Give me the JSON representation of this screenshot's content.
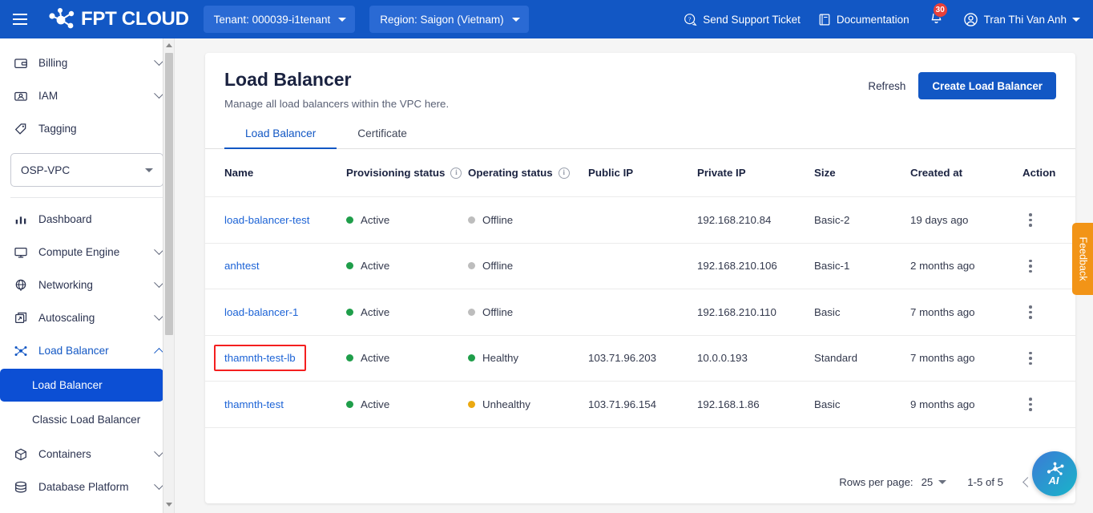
{
  "topbar": {
    "menu_icon": "hamburger-icon",
    "brand": "FPT CLOUD",
    "tenant_label": "Tenant: 000039-i1tenant",
    "region_label": "Region: Saigon (Vietnam)",
    "support_label": "Send Support Ticket",
    "documentation_label": "Documentation",
    "notification_count": "30",
    "user_name": "Tran Thi Van Anh",
    "accent_color": "#1257c4",
    "pill_color": "#2a6ad4",
    "badge_color": "#e8403a"
  },
  "sidebar": {
    "top_items": [
      {
        "label": "Billing",
        "icon": "billing-icon",
        "expandable": true
      },
      {
        "label": "IAM",
        "icon": "iam-icon",
        "expandable": true
      },
      {
        "label": "Tagging",
        "icon": "tag-icon",
        "expandable": false
      }
    ],
    "vpc_selector": {
      "value": "OSP-VPC"
    },
    "items": [
      {
        "label": "Dashboard",
        "icon": "dashboard-icon",
        "expandable": false
      },
      {
        "label": "Compute Engine",
        "icon": "monitor-icon",
        "expandable": true
      },
      {
        "label": "Networking",
        "icon": "globe-icon",
        "expandable": true
      },
      {
        "label": "Autoscaling",
        "icon": "autoscaling-icon",
        "expandable": true
      },
      {
        "label": "Load Balancer",
        "icon": "load-balancer-icon",
        "expandable": true,
        "expanded": true
      },
      {
        "label": "Containers",
        "icon": "container-icon",
        "expandable": true
      },
      {
        "label": "Database Platform",
        "icon": "database-icon",
        "expandable": true
      }
    ],
    "sub_items": [
      {
        "label": "Load Balancer",
        "selected": true
      },
      {
        "label": "Classic Load Balancer",
        "selected": false
      }
    ],
    "selected_color": "#0c4fd4"
  },
  "page": {
    "title": "Load Balancer",
    "subtitle": "Manage all load balancers within the VPC here.",
    "refresh_label": "Refresh",
    "create_label": "Create Load Balancer"
  },
  "tabs": [
    {
      "label": "Load Balancer",
      "active": true
    },
    {
      "label": "Certificate",
      "active": false
    }
  ],
  "table": {
    "columns": [
      {
        "label": "Name",
        "has_info": false
      },
      {
        "label": "Provisioning status",
        "has_info": true
      },
      {
        "label": "Operating status",
        "has_info": true
      },
      {
        "label": "Public IP",
        "has_info": false
      },
      {
        "label": "Private IP",
        "has_info": false
      },
      {
        "label": "Size",
        "has_info": false
      },
      {
        "label": "Created at",
        "has_info": false
      },
      {
        "label": "Action",
        "has_info": false
      }
    ],
    "rows": [
      {
        "name": "load-balancer-test",
        "highlighted": false,
        "provisioning": "Active",
        "provisioning_color": "#1f9e4a",
        "operating": "Offline",
        "operating_color": "#bdbdbd",
        "public_ip": "",
        "private_ip": "192.168.210.84",
        "size": "Basic-2",
        "created_at": "19 days ago"
      },
      {
        "name": "anhtest",
        "highlighted": false,
        "provisioning": "Active",
        "provisioning_color": "#1f9e4a",
        "operating": "Offline",
        "operating_color": "#bdbdbd",
        "public_ip": "",
        "private_ip": "192.168.210.106",
        "size": "Basic-1",
        "created_at": "2 months ago"
      },
      {
        "name": "load-balancer-1",
        "highlighted": false,
        "provisioning": "Active",
        "provisioning_color": "#1f9e4a",
        "operating": "Offline",
        "operating_color": "#bdbdbd",
        "public_ip": "",
        "private_ip": "192.168.210.110",
        "size": "Basic",
        "created_at": "7 months ago"
      },
      {
        "name": "thamnth-test-lb",
        "highlighted": true,
        "provisioning": "Active",
        "provisioning_color": "#1f9e4a",
        "operating": "Healthy",
        "operating_color": "#1f9e4a",
        "public_ip": "103.71.96.203",
        "private_ip": "10.0.0.193",
        "size": "Standard",
        "created_at": "7 months ago"
      },
      {
        "name": "thamnth-test",
        "highlighted": false,
        "provisioning": "Active",
        "provisioning_color": "#1f9e4a",
        "operating": "Unhealthy",
        "operating_color": "#eba911",
        "public_ip": "103.71.96.154",
        "private_ip": "192.168.1.86",
        "size": "Basic",
        "created_at": "9 months ago"
      }
    ]
  },
  "pagination": {
    "rows_per_page_label": "Rows per page:",
    "rows_per_page_value": "25",
    "range_label": "1-5 of 5"
  },
  "feedback": {
    "label": "Feedback",
    "color": "#f29417"
  },
  "ai_fab": {
    "icon": "ai-assistant-icon"
  }
}
